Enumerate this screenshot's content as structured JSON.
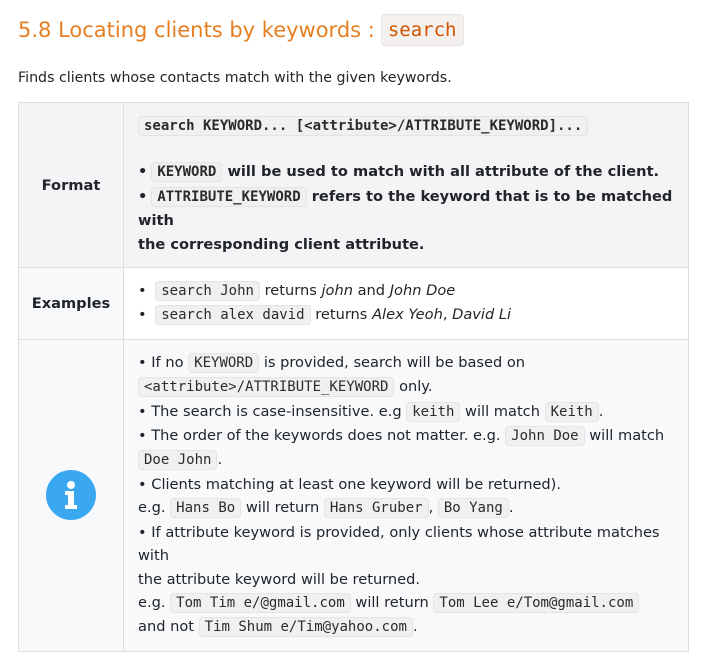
{
  "section": {
    "title_text": "5.8 Locating clients by keywords :",
    "title_code": "search",
    "intro": "Finds clients whose contacts match with the given keywords."
  },
  "format": {
    "label": "Format",
    "command": "search KEYWORD... [<attribute>/ATTRIBUTE_KEYWORD]...",
    "bullet1_code": "KEYWORD",
    "bullet1_text": "will be used to match with all attribute of the client.",
    "bullet2_code": "ATTRIBUTE_KEYWORD",
    "bullet2_text_a": "refers to the keyword that is to be matched with",
    "bullet2_text_b": "the corresponding client attribute."
  },
  "examples": {
    "label": "Examples",
    "ex1_code": "search John",
    "ex1_returns": "returns",
    "ex1_r1": "john",
    "ex1_and": "and",
    "ex1_r2": "John Doe",
    "ex2_code": "search alex david",
    "ex2_returns": "returns",
    "ex2_r1": "Alex Yeoh",
    "ex2_sep": ",",
    "ex2_r2": "David Li"
  },
  "info": {
    "icon": "info-icon",
    "icon_color": "#3aa8f0",
    "l1_a": "If no",
    "l1_code": "KEYWORD",
    "l1_b": "is provided, search will be based on",
    "l2_code": "<attribute>/ATTRIBUTE_KEYWORD",
    "l2_b": "only.",
    "l3_a": "The search is case-insensitive. e.g",
    "l3_code1": "keith",
    "l3_b": "will match",
    "l3_code2": "Keith",
    "l3_c": ".",
    "l4_a": "The order of the keywords does not matter. e.g.",
    "l4_code1": "John Doe",
    "l4_b": "will match",
    "l5_code": "Doe John",
    "l5_b": ".",
    "l6_a": "Clients matching at least one keyword will be returned).",
    "l7_a": "e.g.",
    "l7_code1": "Hans Bo",
    "l7_b": "will return",
    "l7_code2": "Hans Gruber",
    "l7_c": ",",
    "l7_code3": "Bo Yang",
    "l7_d": ".",
    "l8_a": "If attribute keyword is provided, only clients whose attribute matches with",
    "l9_a": "the attribute keyword will be returned.",
    "l10_a": "e.g.",
    "l10_code1": "Tom Tim e/@gmail.com",
    "l10_b": "will return",
    "l10_code2": "Tom Lee e/Tom@gmail.com",
    "l11_a": "and not",
    "l11_code": "Tim Shum e/Tim@yahoo.com",
    "l11_b": "."
  }
}
